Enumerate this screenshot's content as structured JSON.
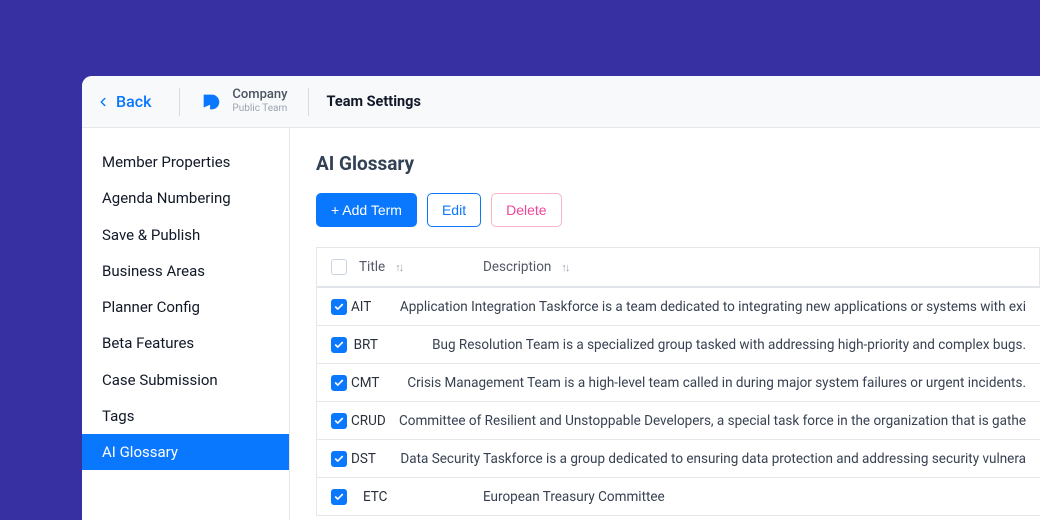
{
  "topbar": {
    "back_label": "Back",
    "company_name": "Company",
    "company_sub": "Public Team",
    "page_title": "Team Settings"
  },
  "sidebar": {
    "items": [
      {
        "label": "Member Properties",
        "active": false
      },
      {
        "label": "Agenda Numbering",
        "active": false
      },
      {
        "label": "Save & Publish",
        "active": false
      },
      {
        "label": "Business Areas",
        "active": false
      },
      {
        "label": "Planner Config",
        "active": false
      },
      {
        "label": "Beta Features",
        "active": false
      },
      {
        "label": "Case Submission",
        "active": false
      },
      {
        "label": "Tags",
        "active": false
      },
      {
        "label": "AI Glossary",
        "active": true
      }
    ]
  },
  "content": {
    "title": "AI Glossary",
    "actions": {
      "add_label": "+ Add Term",
      "edit_label": "Edit",
      "delete_label": "Delete"
    },
    "columns": {
      "title": "Title",
      "description": "Description"
    },
    "rows": [
      {
        "checked": true,
        "title": "AIT",
        "description": "Application Integration Taskforce is a team dedicated to integrating new applications or systems with exi"
      },
      {
        "checked": true,
        "title": "BRT",
        "description": "Bug Resolution Team is a specialized group tasked with addressing high-priority and complex bugs."
      },
      {
        "checked": true,
        "title": "CMT",
        "description": "Crisis Management Team is a high-level team called in during major system failures or urgent incidents."
      },
      {
        "checked": true,
        "title": "CRUD",
        "description": "Committee of Resilient and Unstoppable Developers, a special task force in the organization that is gathe"
      },
      {
        "checked": true,
        "title": "DST",
        "description": "Data Security Taskforce is a group dedicated to ensuring data protection and addressing security vulnera"
      },
      {
        "checked": true,
        "title": "ETC",
        "description": "European Treasury Committee"
      }
    ]
  },
  "colors": {
    "accent": "#0978ff",
    "danger": "#ec4899",
    "page_bg": "#3730a3"
  }
}
